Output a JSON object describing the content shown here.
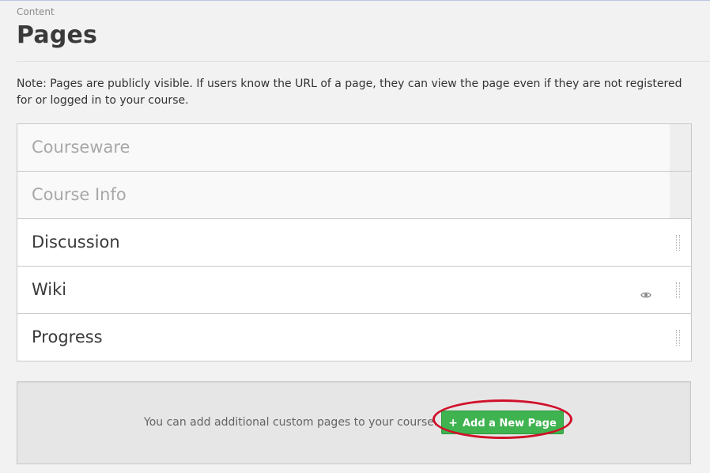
{
  "breadcrumb": "Content",
  "title": "Pages",
  "note": "Note: Pages are publicly visible. If users know the URL of a page, they can view the page even if they are not registered for or logged in to your course.",
  "pages": [
    {
      "label": "Courseware",
      "fixed": true
    },
    {
      "label": "Course Info",
      "fixed": true
    },
    {
      "label": "Discussion",
      "fixed": false
    },
    {
      "label": "Wiki",
      "fixed": false,
      "visibility_icon": "eye-icon"
    },
    {
      "label": "Progress",
      "fixed": false
    }
  ],
  "add_panel": {
    "text": "You can add additional custom pages to your course.",
    "button_label": "Add a New Page",
    "button_icon": "plus-icon"
  },
  "colors": {
    "accent_green": "#3fb34f",
    "highlight_red": "#d0102a"
  }
}
